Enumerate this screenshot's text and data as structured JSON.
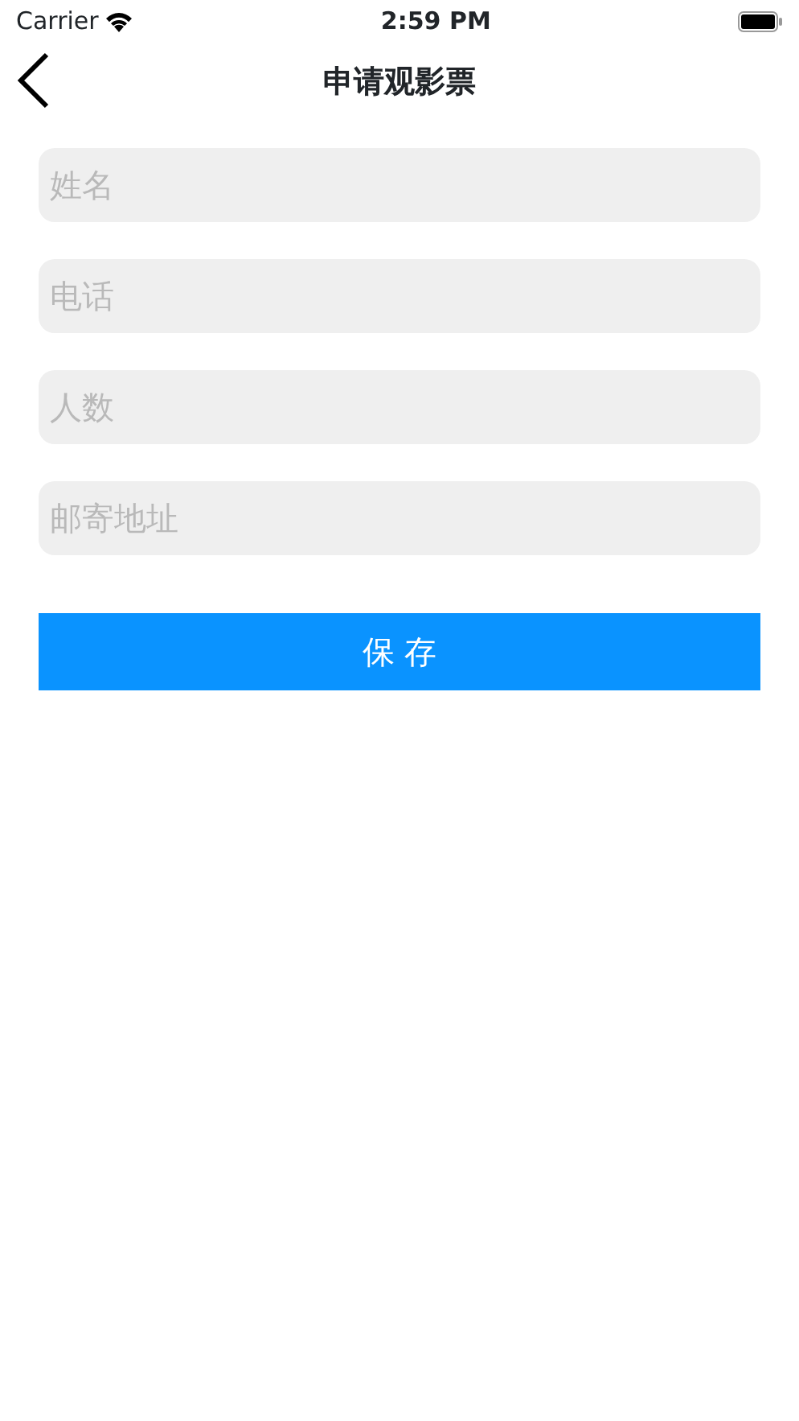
{
  "status_bar": {
    "carrier": "Carrier",
    "time": "2:59 PM"
  },
  "nav_bar": {
    "title": "申请观影票"
  },
  "fields": [
    {
      "placeholder": "姓名"
    },
    {
      "placeholder": "电话"
    },
    {
      "placeholder": "人数"
    },
    {
      "placeholder": "邮寄地址"
    }
  ],
  "save_button": "保 存"
}
